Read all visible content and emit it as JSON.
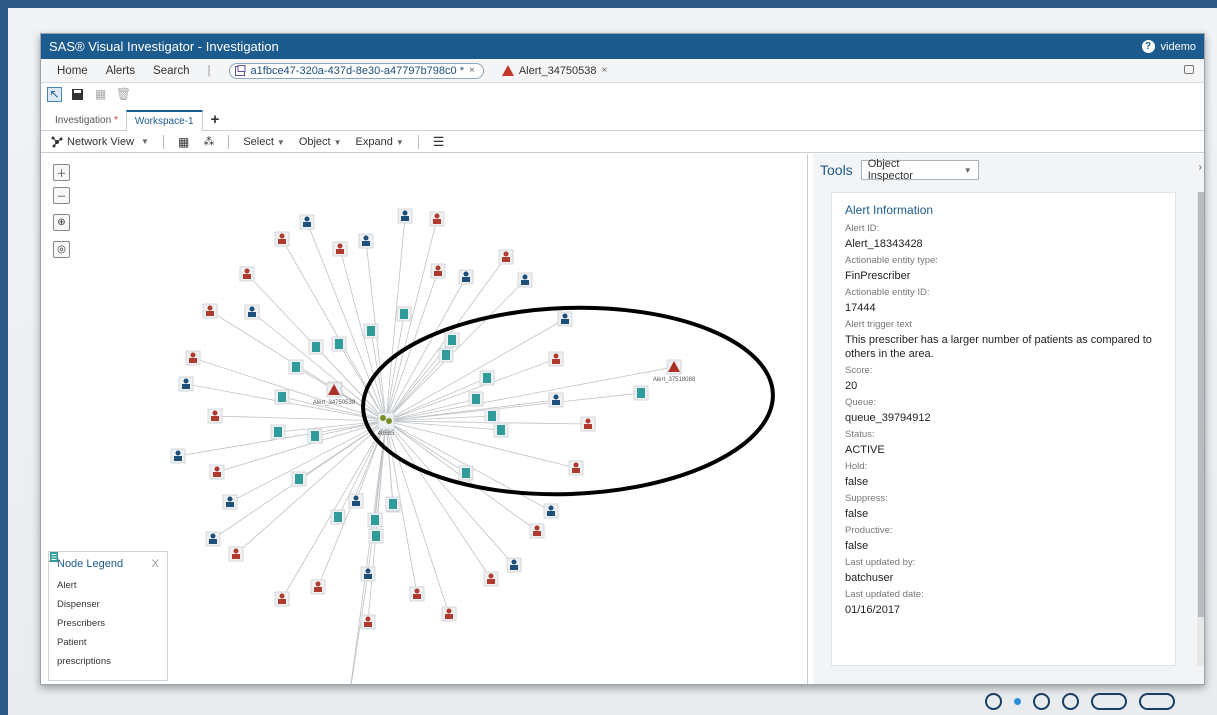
{
  "window": {
    "title": "SAS® Visual Investigator - Investigation",
    "user": "videmo",
    "help_icon": "help-icon"
  },
  "nav": {
    "home": "Home",
    "alerts": "Alerts",
    "search": "Search",
    "sep": "|",
    "tab_investigation": "a1fbce47-320a-437d-8e30-a47797b798c0 *",
    "tab_alert": "Alert_34750538",
    "close": "×"
  },
  "workspace_tabs": {
    "investigation": "Investigation",
    "investigation_star": "*",
    "workspace": "Workspace-1",
    "add": "+"
  },
  "toolbar": {
    "network_view": "Network View",
    "select": "Select",
    "object": "Object",
    "expand": "Expand"
  },
  "graph": {
    "labels": {
      "alert_left": "Alert_34750538",
      "alert_right": "Alert_37518088",
      "alert_bottom": "Alert_18343428",
      "center": "48585"
    }
  },
  "legend": {
    "title": "Node Legend",
    "close": "X",
    "items": [
      {
        "label": "Alert",
        "icon": "alert-icon",
        "color": "#a93226"
      },
      {
        "label": "Dispenser",
        "icon": "dispenser-icon",
        "color": "#7a8f2a"
      },
      {
        "label": "Prescribers",
        "icon": "prescriber-icon",
        "color": "#1c4f7a"
      },
      {
        "label": "Patient",
        "icon": "patient-icon",
        "color": "#b03a2e"
      },
      {
        "label": "prescriptions",
        "icon": "prescription-icon",
        "color": "#2f9b9b"
      }
    ]
  },
  "tools": {
    "label": "Tools",
    "select_value": "Object Inspector"
  },
  "alert_info": {
    "heading": "Alert Information",
    "fields": [
      {
        "label": "Alert ID:",
        "value": "Alert_18343428"
      },
      {
        "label": "Actionable entity type:",
        "value": "FinPrescriber"
      },
      {
        "label": "Actionable entity ID:",
        "value": "17444"
      },
      {
        "label": "Alert trigger text",
        "value": "This prescriber has a larger number of patients as compared to others in the area."
      },
      {
        "label": "Score:",
        "value": "20"
      },
      {
        "label": "Queue:",
        "value": "queue_39794912"
      },
      {
        "label": "Status:",
        "value": "ACTIVE"
      },
      {
        "label": "Hold:",
        "value": "false"
      },
      {
        "label": "Suppress:",
        "value": "false"
      },
      {
        "label": "Productive:",
        "value": "false"
      },
      {
        "label": "Last updated by:",
        "value": "batchuser"
      },
      {
        "label": "Last updated date:",
        "value": "01/16/2017"
      }
    ]
  }
}
